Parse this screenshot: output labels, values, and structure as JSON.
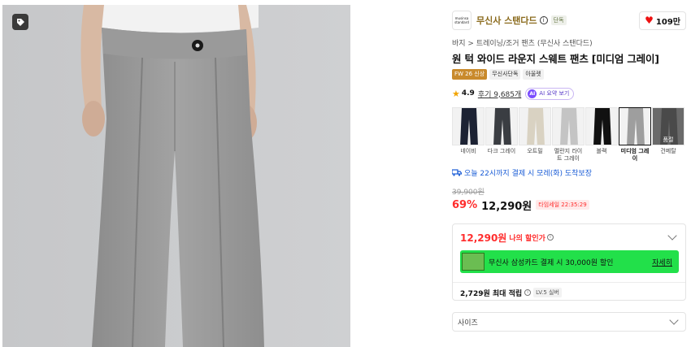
{
  "brand": {
    "logo_text": "musinsa standard",
    "name": "무신사 스탠다드",
    "exclusive_badge": "단독",
    "likes": "109만"
  },
  "breadcrumb": "바지 > 트레이닝/조거 팬츠 (무신사 스탠다드)",
  "product": {
    "title": "원 턱 와이드 라운지 스웨트 팬츠 [미디엄 그레이]",
    "badges": [
      "FW 26 신상",
      "무신사단독",
      "아울렛"
    ]
  },
  "rating": {
    "score": "4.9",
    "reviews": "후기 9,685개",
    "ai_button": "AI 요약 보기",
    "ai_icon": "AI"
  },
  "swatches": [
    {
      "label": "네이비",
      "color": "#1c2233",
      "bg": "#f2f2f2",
      "sold": ""
    },
    {
      "label": "다크 그레이",
      "color": "#3a3d42",
      "bg": "#f2f2f2",
      "sold": ""
    },
    {
      "label": "오트밀",
      "color": "#d9d2c2",
      "bg": "#f2f2f2",
      "sold": ""
    },
    {
      "label": "멜란지 라이트 그레이",
      "color": "#c4c4c4",
      "bg": "#f2f2f2",
      "sold": ""
    },
    {
      "label": "블랙",
      "color": "#111111",
      "bg": "#f2f2f2",
      "sold": ""
    },
    {
      "label": "미디엄 그레이",
      "color": "#9e9e9e",
      "bg": "#f2f2f2",
      "sold": ""
    },
    {
      "label": "건메탈",
      "color": "#4a4a4a",
      "bg": "#6a6a6a",
      "sold": "품절"
    }
  ],
  "delivery": "오늘 22시까지 결제 시 모레(화) 도착보장",
  "pricing": {
    "original": "39,900원",
    "discount": "69%",
    "price": "12,290원",
    "timesale": "타임세일 22:35:29"
  },
  "promo": {
    "my_price": "12,290원",
    "my_price_label": "나의 할인가",
    "card_text": "무신사 삼성카드 결제 시 30,000원 할인",
    "card_more": "자세히",
    "points": "2,729원 최대 적립",
    "level": "LV.5 실버"
  },
  "size_select": {
    "placeholder": "사이즈"
  },
  "colors": {
    "brand_gold": "#8a6a1c",
    "sale_red": "#ff2d2d",
    "card_green": "#22e04a",
    "delivery_blue": "#1a5cd6"
  }
}
